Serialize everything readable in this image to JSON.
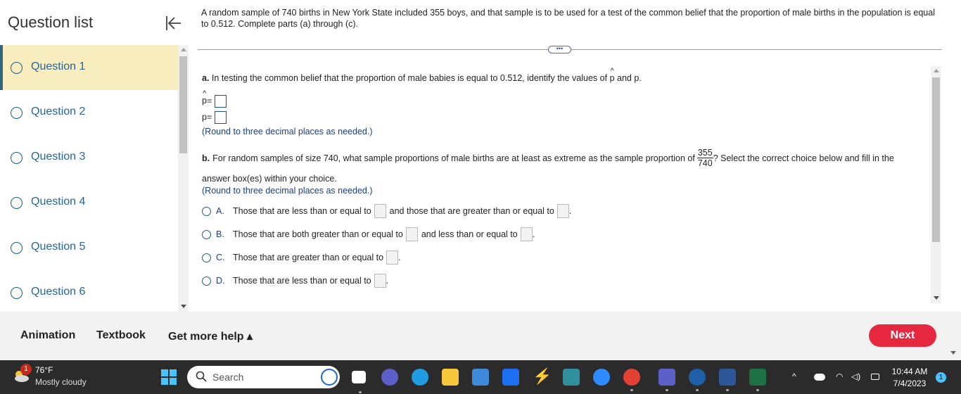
{
  "sidebar": {
    "title": "Question list",
    "items": [
      {
        "label": "Question 1",
        "active": true
      },
      {
        "label": "Question 2",
        "active": false
      },
      {
        "label": "Question 3",
        "active": false
      },
      {
        "label": "Question 4",
        "active": false
      },
      {
        "label": "Question 5",
        "active": false
      },
      {
        "label": "Question 6",
        "active": false
      }
    ]
  },
  "question": {
    "intro": "A random sample of 740 births in New York State included 355 boys, and that sample is to be used for a test of the common belief that the proportion of male births in the population is equal to 0.512. Complete parts (a) through (c).",
    "more_label": "•••",
    "part_a": {
      "prefix": "a.",
      "text": "In testing the common belief that the proportion of male babies is equal to 0.512, identify the values of",
      "symbol_phat": "p",
      "and_text": "and p.",
      "phat_label": "p",
      "p_label": "p",
      "equals": "=",
      "round_hint": "(Round to three decimal places as needed.)"
    },
    "part_b": {
      "prefix": "b.",
      "text_before": "For random samples of size 740, what sample proportions of male births are at least as extreme as the sample proportion of",
      "frac_num": "355",
      "frac_den": "740",
      "text_after": "? Select the correct choice below and fill in the",
      "text_line2": "answer box(es) within your choice.",
      "round_hint": "(Round to three decimal places as needed.)",
      "choices": [
        {
          "letter": "A.",
          "t1": "Those that are less than or equal to",
          "t2": "and those that are greater than or equal to"
        },
        {
          "letter": "B.",
          "t1": "Those that are both greater than or equal to",
          "t2": "and less than or equal to"
        },
        {
          "letter": "C.",
          "t1": "Those that are greater than or equal to",
          "t2": ""
        },
        {
          "letter": "D.",
          "t1": "Those that are less than or equal to",
          "t2": ""
        }
      ]
    }
  },
  "bottom": {
    "animation": "Animation",
    "textbook": "Textbook",
    "help": "Get more help ▴",
    "next": "Next"
  },
  "taskbar": {
    "weather_badge": "1",
    "weather_temp": "76°F",
    "weather_desc": "Mostly cloudy",
    "search_label": "Search",
    "time": "10:44 AM",
    "date": "7/4/2023",
    "notif_count": "1",
    "colors": {
      "accent": "#4cc2ff",
      "next": "#e5283d",
      "active_item": "#f7edbe"
    }
  }
}
